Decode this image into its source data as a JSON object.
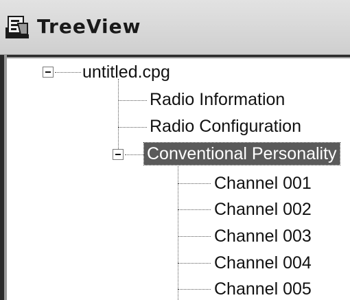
{
  "window": {
    "title": "TreeView",
    "icon": "treeview-app-icon"
  },
  "tree": {
    "root": {
      "label": "untitled.cpg",
      "expanded": true
    },
    "children": [
      {
        "label": "Radio Information"
      },
      {
        "label": "Radio Configuration"
      },
      {
        "label": "Conventional Personality",
        "expanded": true,
        "selected": true
      }
    ],
    "channels": [
      {
        "label": "Channel 001"
      },
      {
        "label": "Channel 002"
      },
      {
        "label": "Channel 003"
      },
      {
        "label": "Channel 004"
      },
      {
        "label": "Channel 005"
      }
    ]
  }
}
